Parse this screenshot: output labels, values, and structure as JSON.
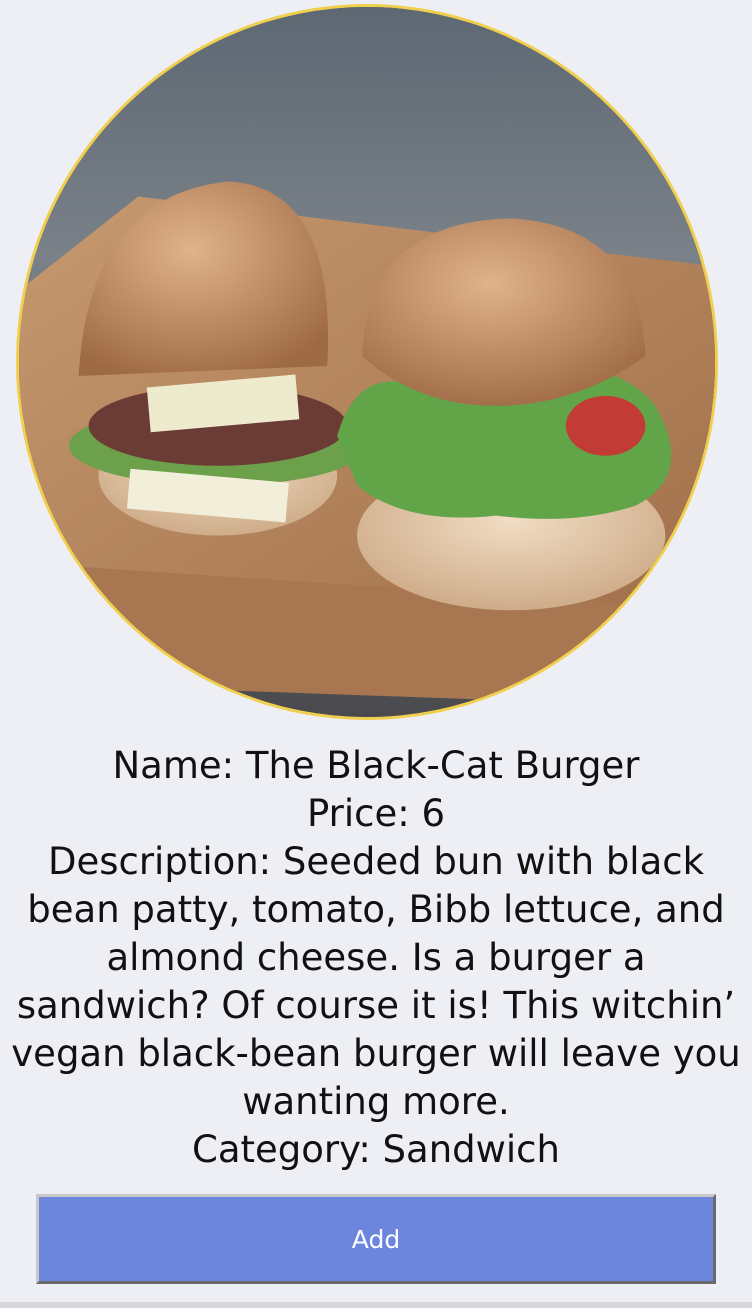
{
  "item": {
    "image_subject": "two-burgers-on-cutting-board",
    "name_line": "Name: The Black-Cat Burger",
    "price_line": "Price: 6",
    "description_line": "Description: Seeded bun with black bean patty, tomato, Bibb lettuce, and almond cheese. Is a burger a sandwich? Of course it is! This witchin’ vegan black-bean burger will leave you wanting more.",
    "category_line": "Category: Sandwich"
  },
  "actions": {
    "add_label": "Add"
  },
  "colors": {
    "frame_border": "#f1cf4e",
    "button": "#6b86dc",
    "background": "#eeeff4"
  }
}
